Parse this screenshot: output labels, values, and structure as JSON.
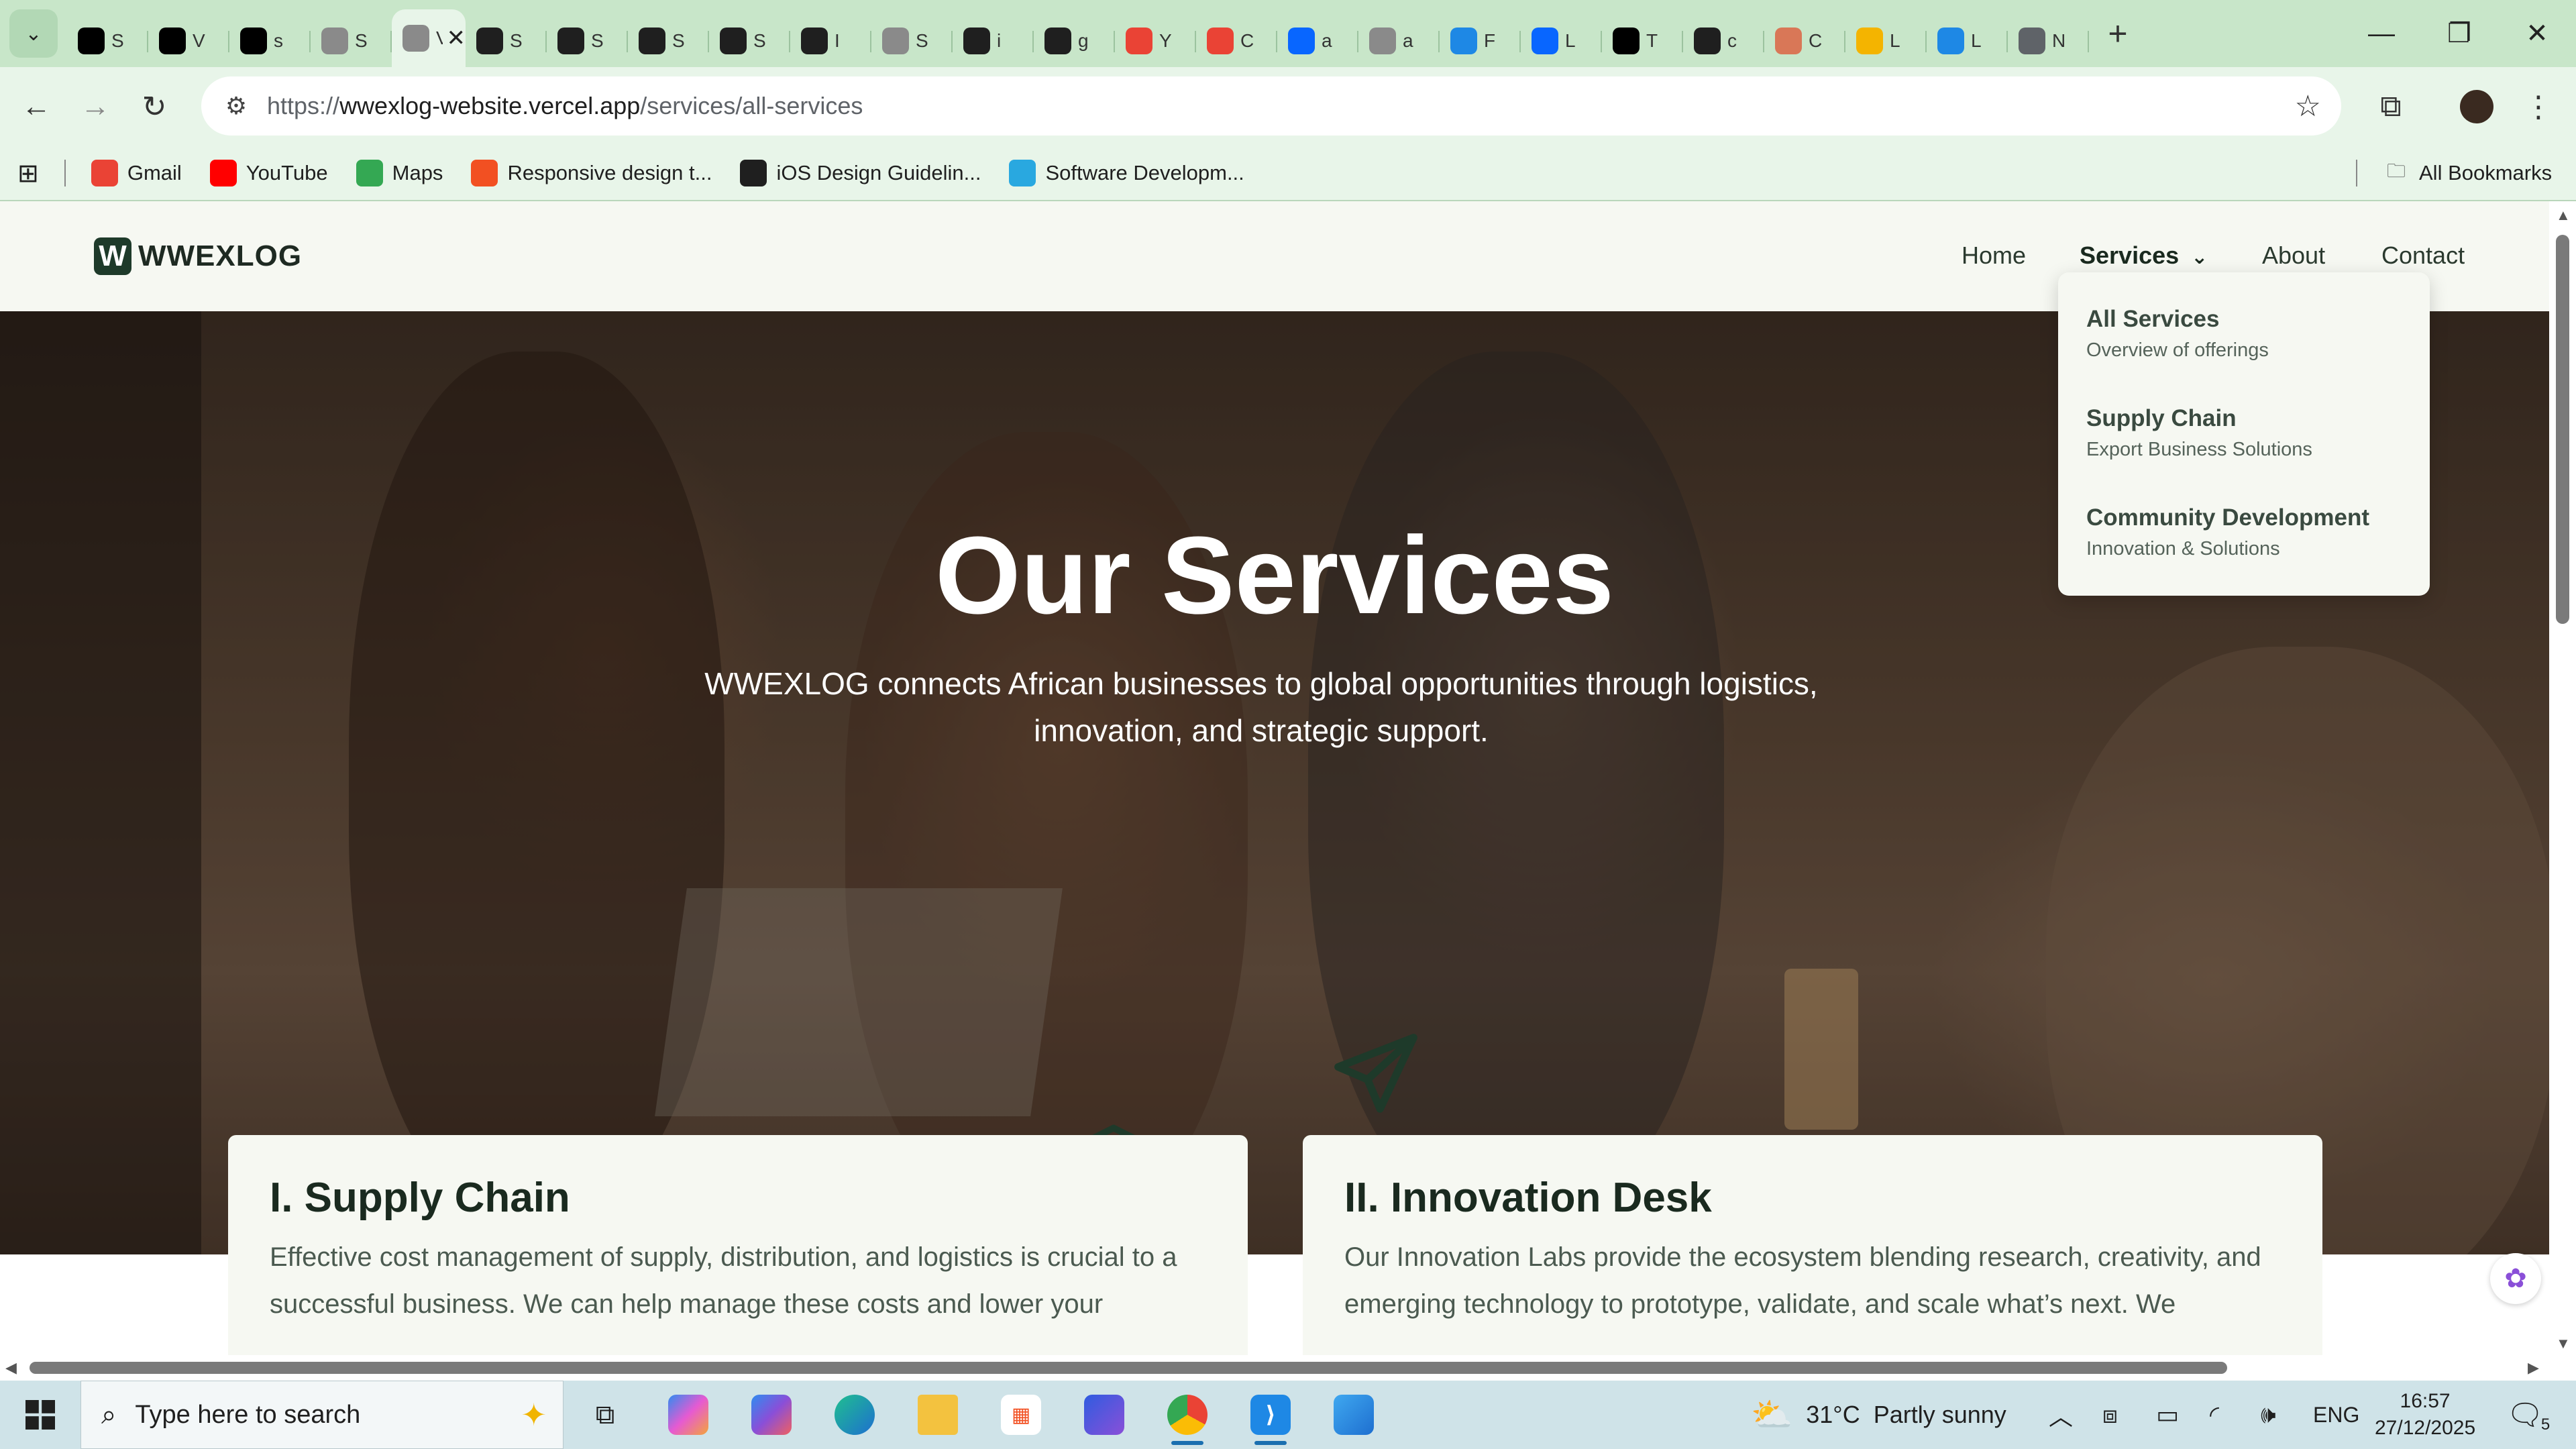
{
  "browser": {
    "tabs": [
      {
        "icon": "vercel-icon",
        "letter": "S",
        "color": "#000000"
      },
      {
        "icon": "tab-app-icon",
        "letter": "V",
        "color": "#000000"
      },
      {
        "icon": "tab-app-icon",
        "letter": "s",
        "color": "#000000"
      },
      {
        "icon": "globe-icon",
        "letter": "S",
        "color": "#8a8a8a"
      },
      {
        "icon": "globe-icon",
        "letter": "V",
        "color": "#8a8a8a",
        "active": true
      },
      {
        "icon": "github-icon",
        "letter": "S",
        "color": "#1f1f1f"
      },
      {
        "icon": "github-icon",
        "letter": "S",
        "color": "#1f1f1f"
      },
      {
        "icon": "github-icon",
        "letter": "S",
        "color": "#1f1f1f"
      },
      {
        "icon": "github-icon",
        "letter": "S",
        "color": "#1f1f1f"
      },
      {
        "icon": "github-icon",
        "letter": "I",
        "color": "#1f1f1f"
      },
      {
        "icon": "globe-icon",
        "letter": "S",
        "color": "#8a8a8a"
      },
      {
        "icon": "github-icon",
        "letter": "i",
        "color": "#1f1f1f"
      },
      {
        "icon": "github-icon",
        "letter": "g",
        "color": "#1f1f1f"
      },
      {
        "icon": "gmail-icon",
        "letter": "Y",
        "color": "#ea4335"
      },
      {
        "icon": "gmail-icon",
        "letter": "C",
        "color": "#ea4335"
      },
      {
        "icon": "meta-icon",
        "letter": "a",
        "color": "#0866ff"
      },
      {
        "icon": "globe-icon",
        "letter": "a",
        "color": "#8a8a8a"
      },
      {
        "icon": "cloud-icon",
        "letter": "F",
        "color": "#1e88e5"
      },
      {
        "icon": "meta-icon",
        "letter": "L",
        "color": "#0866ff"
      },
      {
        "icon": "notion-icon",
        "letter": "T",
        "color": "#000000"
      },
      {
        "icon": "github-icon",
        "letter": "c",
        "color": "#1f1f1f"
      },
      {
        "icon": "claude-icon",
        "letter": "C",
        "color": "#d97757"
      },
      {
        "icon": "course-icon",
        "letter": "L",
        "color": "#f4b400"
      },
      {
        "icon": "edge-icon",
        "letter": "L",
        "color": "#1e88e5"
      },
      {
        "icon": "chrome-icon",
        "letter": "N",
        "color": "#5f6368"
      }
    ],
    "active_tab_close": "✕",
    "new_tab": "+",
    "url_scheme": "https://",
    "url_host": "wwexlog-website.vercel.app",
    "url_path": "/services/all-services",
    "bookmarks": [
      {
        "label": "Gmail",
        "icon": "gmail-icon",
        "color": "#ea4335"
      },
      {
        "label": "YouTube",
        "icon": "youtube-icon",
        "color": "#ff0000"
      },
      {
        "label": "Maps",
        "icon": "maps-icon",
        "color": "#34a853"
      },
      {
        "label": "Responsive design t...",
        "icon": "microsoft-icon",
        "color": "#f25022"
      },
      {
        "label": "iOS Design Guidelin...",
        "icon": "l-app-icon",
        "color": "#1f1f1f"
      },
      {
        "label": "Software Developm...",
        "icon": "circle-app-icon",
        "color": "#29a8e0"
      }
    ],
    "all_bookmarks": "All Bookmarks"
  },
  "site": {
    "logo_mark": "W",
    "logo_text": "WWEXLOG",
    "nav": {
      "home": "Home",
      "services": "Services",
      "about": "About",
      "contact": "Contact"
    },
    "dropdown": [
      {
        "title": "All Services",
        "subtitle": "Overview of offerings"
      },
      {
        "title": "Supply Chain",
        "subtitle": "Export Business Solutions"
      },
      {
        "title": "Community Development",
        "subtitle": "Innovation & Solutions"
      }
    ],
    "hero": {
      "title": "Our Services",
      "subtitle": "WWEXLOG connects African businesses to global opportunities through logistics, innovation, and strategic support."
    },
    "cards": [
      {
        "title": "I. Supply Chain",
        "text": "Effective cost management of supply, distribution, and logistics is crucial to a successful business. We can help manage these costs and lower your"
      },
      {
        "title": "II. Innovation Desk",
        "text": "Our Innovation Labs provide the ecosystem blending research, creativity, and emerging technology to prototype, validate, and scale what’s next. We"
      }
    ],
    "accent_color": "#1e3a2a"
  },
  "taskbar": {
    "search_placeholder": "Type here to search",
    "weather": "31°C  Partly sunny",
    "language": "ENG",
    "time": "16:57",
    "date": "27/12/2025",
    "notifications": "5"
  }
}
